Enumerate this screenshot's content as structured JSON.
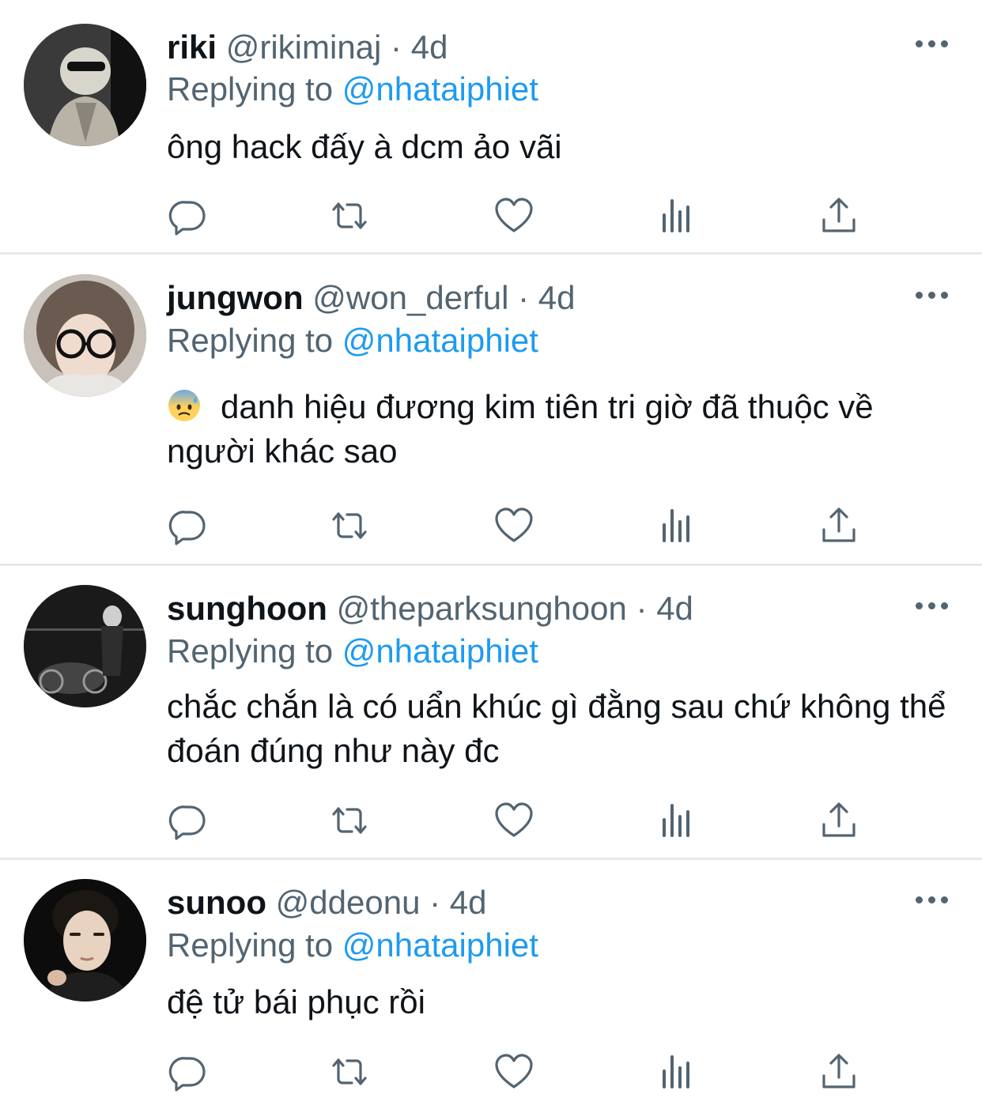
{
  "replying_label": "Replying to",
  "colors": {
    "link": "#1d9bf0",
    "secondary": "#536471",
    "text": "#0f1419",
    "divider": "#e7e9ec"
  },
  "icons": {
    "reply": "reply-icon",
    "retweet": "retweet-icon",
    "like": "heart-icon",
    "views": "analytics-icon",
    "share": "share-icon",
    "more": "more-icon"
  },
  "tweets": [
    {
      "name": "riki",
      "handle": "@rikiminaj",
      "sep": "·",
      "time": "4d",
      "reply_to": "@nhataiphiet",
      "text": "ông hack đấy à dcm ảo vãi"
    },
    {
      "name": "jungwon",
      "handle": "@won_derful",
      "sep": "·",
      "time": "4d",
      "reply_to": "@nhataiphiet",
      "emoji": "anxious-face-with-sweat",
      "text": "danh hiệu đương kim tiên tri giờ đã thuộc về người khác sao"
    },
    {
      "name": "sunghoon",
      "handle": "@theparksunghoon",
      "sep": "·",
      "time": "4d",
      "reply_to": "@nhataiphiet",
      "text": "chắc chắn là có uẩn khúc gì đằng sau chứ không thể đoán đúng như này đc"
    },
    {
      "name": "sunoo",
      "handle": "@ddeonu",
      "sep": "·",
      "time": "4d",
      "reply_to": "@nhataiphiet",
      "text": "đệ tử bái phục rồi"
    }
  ]
}
